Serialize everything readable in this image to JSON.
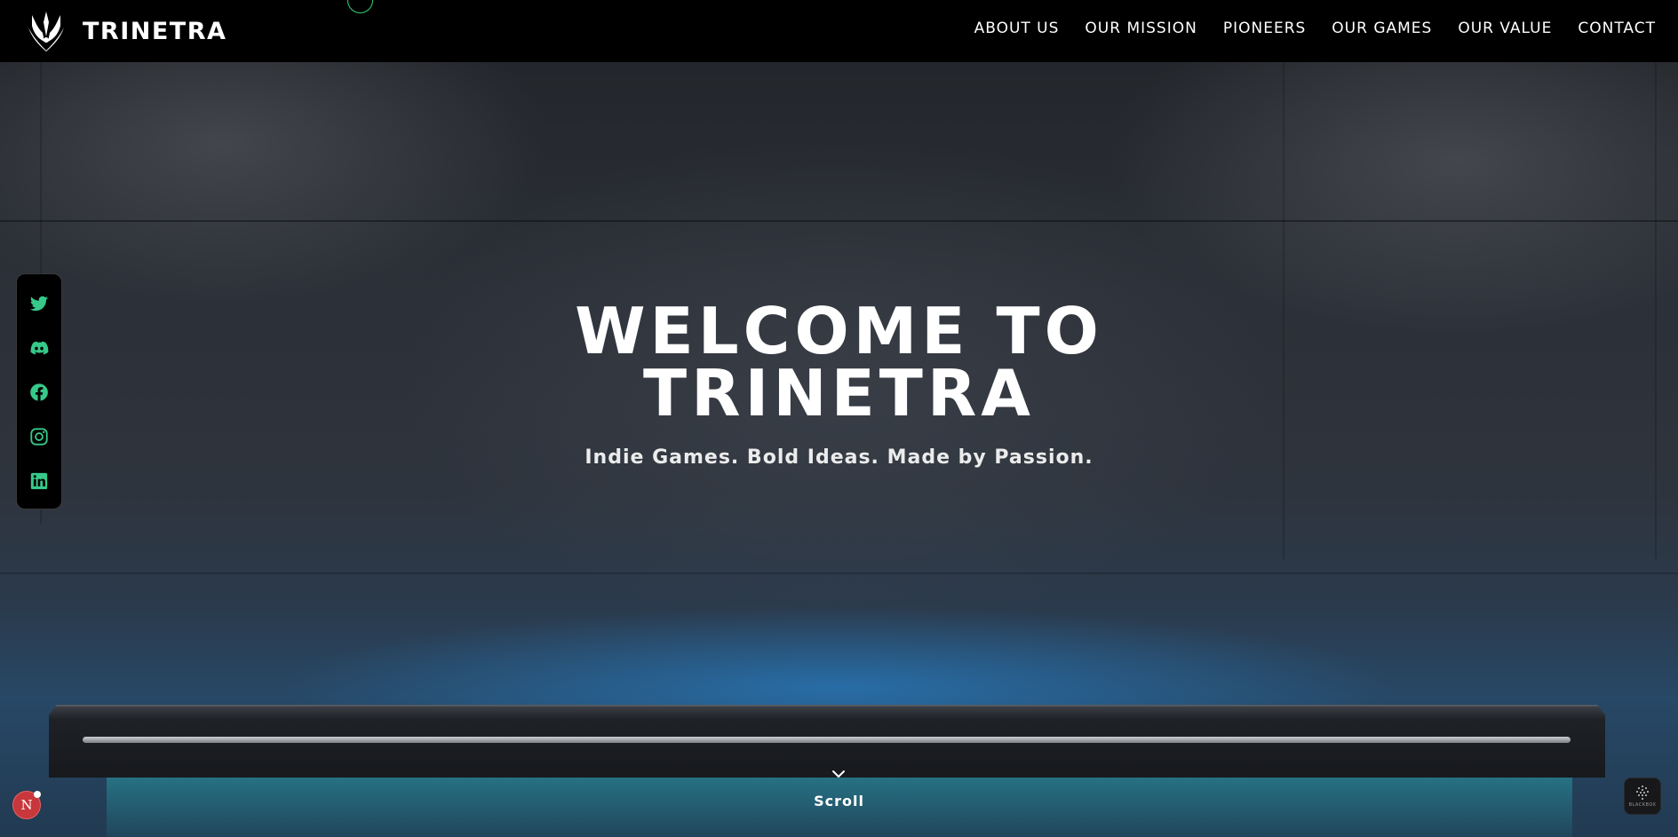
{
  "brand": {
    "name": "TRINETRA",
    "logo_icon": "trident-logo-icon"
  },
  "nav": {
    "links": [
      {
        "label": "ABOUT US"
      },
      {
        "label": "OUR MISSION"
      },
      {
        "label": "PIONEERS"
      },
      {
        "label": "OUR GAMES"
      },
      {
        "label": "OUR VALUE"
      },
      {
        "label": "CONTACT"
      }
    ]
  },
  "hero": {
    "title_line1": "WELCOME TO",
    "title_line2": "TRINETRA",
    "subtitle": "Indie Games. Bold Ideas. Made by Passion."
  },
  "social": {
    "icon_color": "#36c98a",
    "items": [
      {
        "icon": "twitter-icon"
      },
      {
        "icon": "discord-icon"
      },
      {
        "icon": "facebook-icon"
      },
      {
        "icon": "instagram-icon"
      },
      {
        "icon": "linkedin-icon"
      }
    ]
  },
  "scroll": {
    "label": "Scroll",
    "icon": "chevron-down-icon"
  },
  "floating": {
    "left_badge_letter": "N",
    "right_widget_label": "BLACKBOX"
  },
  "colors": {
    "accent_green": "#36c98a",
    "nav_bg": "#000000",
    "glow_blue": "#2a8fe0"
  }
}
